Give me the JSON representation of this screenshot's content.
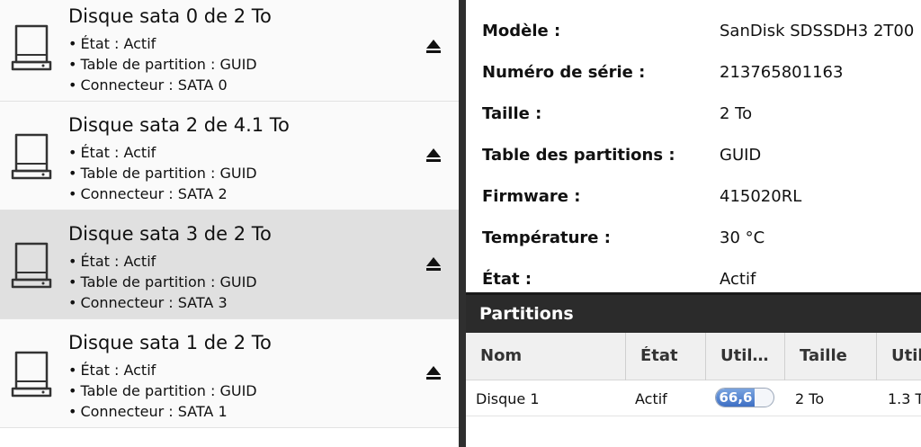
{
  "disks": [
    {
      "title": "Disque sata 0 de 2 To",
      "state": "État : Actif",
      "partition_table": "Table de partition : GUID",
      "connector": "Connecteur : SATA 0",
      "selected": false
    },
    {
      "title": "Disque sata 2 de 4.1 To",
      "state": "État : Actif",
      "partition_table": "Table de partition : GUID",
      "connector": "Connecteur : SATA 2",
      "selected": false
    },
    {
      "title": "Disque sata 3 de 2 To",
      "state": "État : Actif",
      "partition_table": "Table de partition : GUID",
      "connector": "Connecteur : SATA 3",
      "selected": true
    },
    {
      "title": "Disque sata 1 de 2 To",
      "state": "État : Actif",
      "partition_table": "Table de partition : GUID",
      "connector": "Connecteur : SATA 1",
      "selected": false
    }
  ],
  "bullet": "•",
  "icons": {
    "disk": "hard-drive-icon",
    "eject": "eject-icon"
  },
  "details": [
    {
      "label": "Modèle :",
      "value": "SanDisk SDSSDH3 2T00"
    },
    {
      "label": "Numéro de série :",
      "value": "213765801163"
    },
    {
      "label": "Taille :",
      "value": "2 To"
    },
    {
      "label": "Table des partitions :",
      "value": "GUID"
    },
    {
      "label": "Firmware :",
      "value": "415020RL"
    },
    {
      "label": "Température :",
      "value": "30 °C"
    },
    {
      "label": "État :",
      "value": "Actif"
    }
  ],
  "partitions": {
    "title": "Partitions",
    "columns": [
      "Nom",
      "État",
      "Util…",
      "Taille",
      "Util"
    ],
    "rows": [
      {
        "name": "Disque 1",
        "state": "Actif",
        "usage_text": "66,6",
        "usage_percent": 66.6,
        "size": "2 To",
        "used": "1.3 T"
      }
    ]
  },
  "colors": {
    "selected_row": "#e0e0e0",
    "header_dark": "#2b2b2b",
    "usage_fill": "#3d6fc4"
  }
}
